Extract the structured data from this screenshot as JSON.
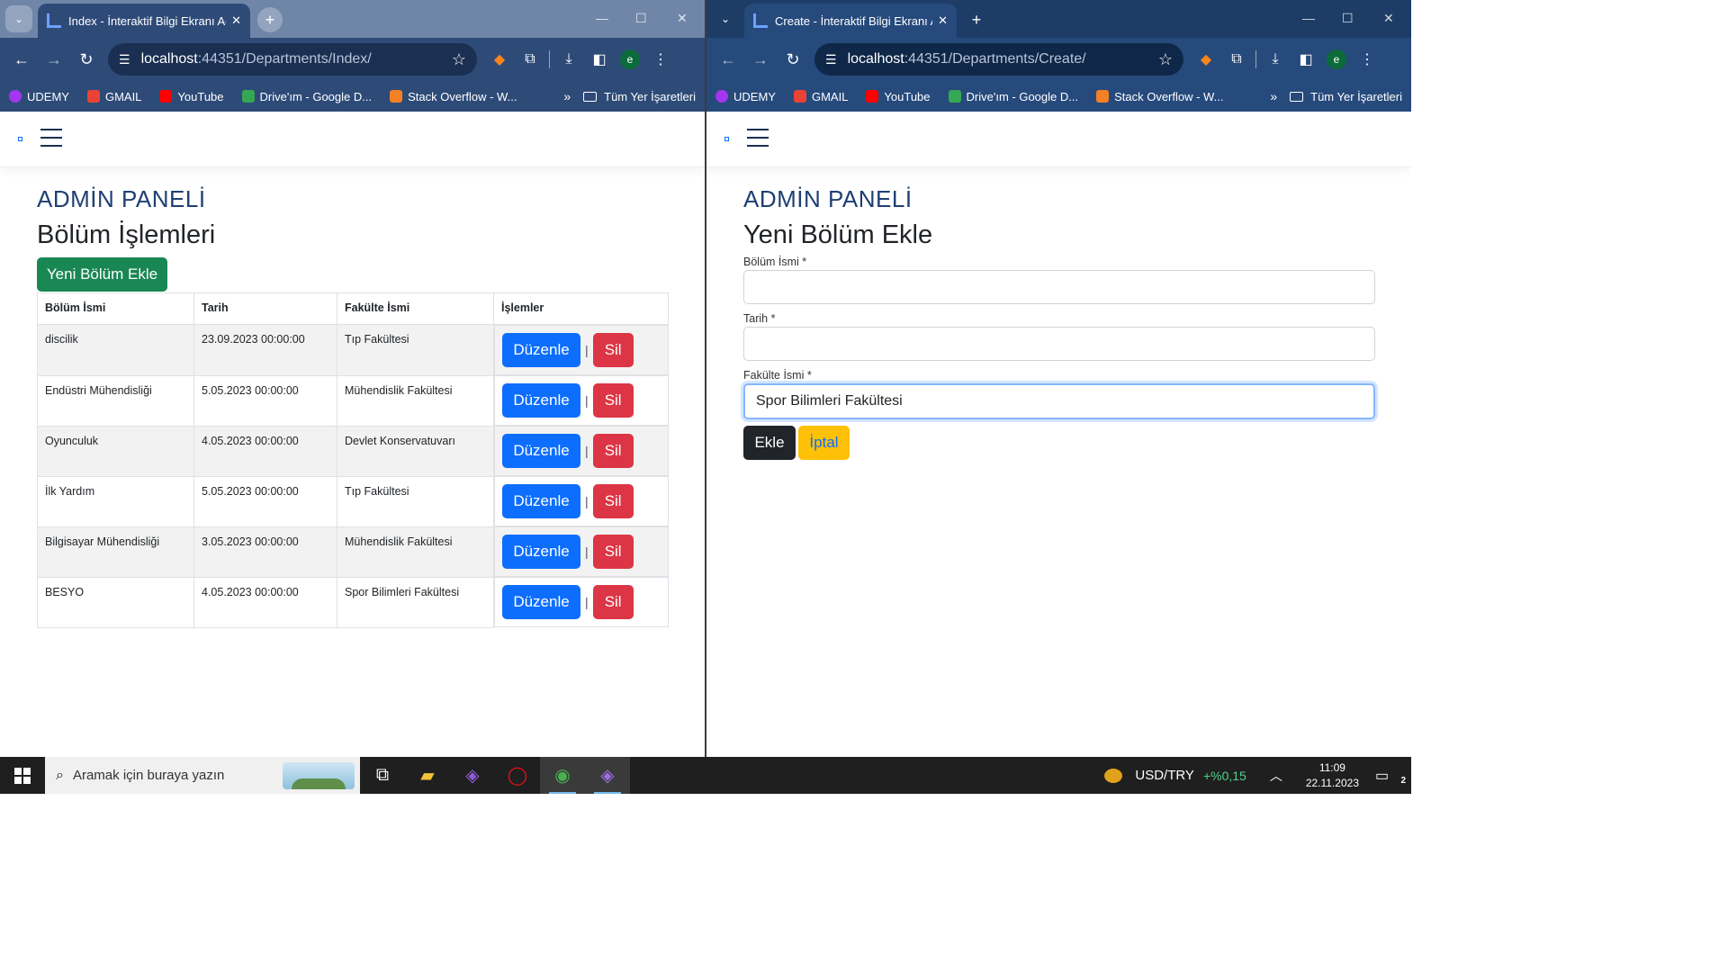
{
  "left_window": {
    "tab_title": "Index - İnteraktif Bilgi Ekranı Ad",
    "url_host": "localhost",
    "url_path": ":44351/Departments/Index/",
    "bookmarks": [
      {
        "label": "UDEMY",
        "icon": "udemy-icon",
        "color": "#a435f0"
      },
      {
        "label": "GMAIL",
        "icon": "gmail-icon",
        "color": "#ea4335"
      },
      {
        "label": "YouTube",
        "icon": "youtube-icon",
        "color": "#ff0000"
      },
      {
        "label": "Drive'ım - Google D...",
        "icon": "drive-icon",
        "color": "#34a853"
      },
      {
        "label": "Stack Overflow - W...",
        "icon": "stackoverflow-icon",
        "color": "#f48024"
      }
    ],
    "bookmarks_folder": "Tüm Yer İşaretleri",
    "page": {
      "admin_title": "ADMİN PANELİ",
      "heading": "Bölüm İşlemleri",
      "add_button": "Yeni Bölüm Ekle",
      "columns": [
        "Bölüm İsmi",
        "Tarih",
        "Fakülte İsmi",
        "İşlemler"
      ],
      "rows": [
        {
          "name": "discilik",
          "date": "23.09.2023 00:00:00",
          "faculty": "Tıp Fakültesi"
        },
        {
          "name": "Endüstri Mühendisliği",
          "date": "5.05.2023 00:00:00",
          "faculty": "Mühendislik Fakültesi"
        },
        {
          "name": "Oyunculuk",
          "date": "4.05.2023 00:00:00",
          "faculty": "Devlet Konservatuvarı"
        },
        {
          "name": "İlk Yardım",
          "date": "5.05.2023 00:00:00",
          "faculty": "Tıp Fakültesi"
        },
        {
          "name": "Bilgisayar Mühendisliği",
          "date": "3.05.2023 00:00:00",
          "faculty": "Mühendislik Fakültesi"
        },
        {
          "name": "BESYO",
          "date": "4.05.2023 00:00:00",
          "faculty": "Spor Bilimleri Fakültesi"
        }
      ],
      "edit_label": "Düzenle",
      "delete_label": "Sil",
      "ops_separator": "|"
    }
  },
  "right_window": {
    "tab_title": "Create - İnteraktif Bilgi Ekranı A",
    "url_host": "localhost",
    "url_path": ":44351/Departments/Create/",
    "bookmarks_folder": "Tüm Yer İşaretleri",
    "page": {
      "admin_title": "ADMİN PANELİ",
      "heading": "Yeni Bölüm Ekle",
      "fields": [
        {
          "label": "Bölüm İsmi *",
          "value": ""
        },
        {
          "label": "Tarih *",
          "value": ""
        },
        {
          "label": "Fakülte İsmi *",
          "value": "Spor Bilimleri Fakültesi"
        }
      ],
      "submit_label": "Ekle",
      "cancel_label": "İptal"
    }
  },
  "avatar_letter": "e",
  "taskbar": {
    "search_placeholder": "Aramak için buraya yazın",
    "fx_pair": "USD/TRY",
    "fx_change": "+%0,15",
    "time": "11:09",
    "date": "22.11.2023",
    "notification_count": "2"
  },
  "colors": {
    "primary": "#0d6efd",
    "success": "#198754",
    "danger": "#dc3545",
    "warning": "#ffc107",
    "dark": "#212529"
  }
}
